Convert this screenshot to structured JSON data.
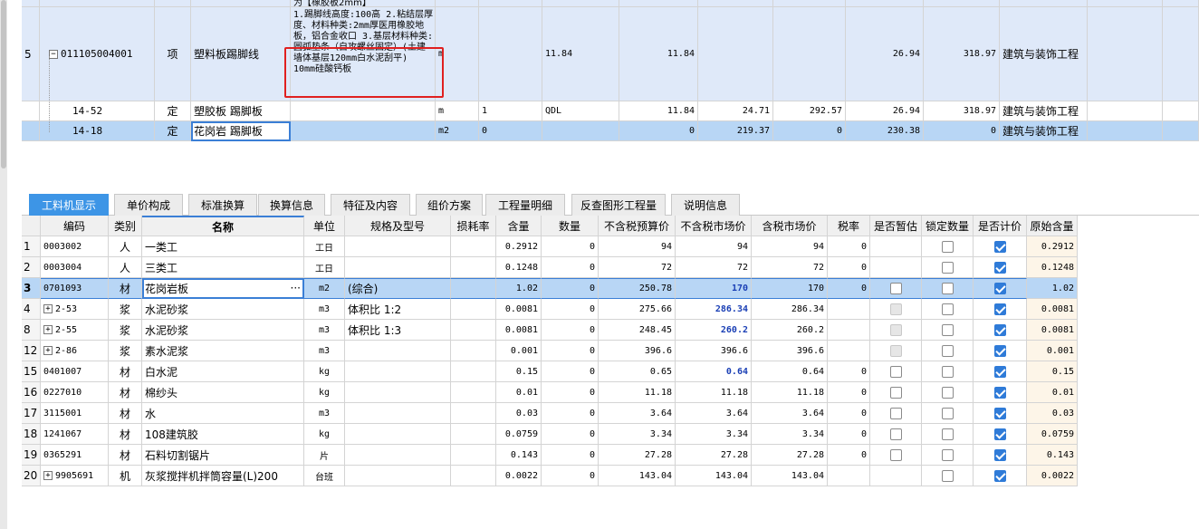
{
  "top_rows": [
    {
      "no": "",
      "code": "",
      "type": "",
      "name": "",
      "desc_partial": "为【橡胶板2mm】"
    },
    {
      "no": "5",
      "code": "011105004001",
      "type": "项",
      "name": "塑料板踢脚线",
      "desc": "1.踢脚线高度:100高 2.粘结层厚度、材料种类:2mm厚医用橡胶地板，铝合金收口 3.基层材料种类:圆弧垫条（自攻螺丝固定）(土建墙体基层120mm白水泥刮平) 10mm硅酸钙板",
      "unit": "m",
      "qty": "",
      "qty_formula": "11.84",
      "amount": "11.84",
      "price": "",
      "total": "",
      "unit_price": "26.94",
      "sum": "318.97",
      "category": "建筑与装饰工程"
    },
    {
      "no": "",
      "code": "14-52",
      "type": "定",
      "name": "塑胶板 踢脚板",
      "desc": "",
      "unit": "m",
      "qty": "1",
      "qty_formula": "QDL",
      "amount": "11.84",
      "price": "24.71",
      "total": "292.57",
      "unit_price": "26.94",
      "sum": "318.97",
      "category": "建筑与装饰工程"
    },
    {
      "no": "",
      "code": "14-18",
      "type": "定",
      "name": "花岗岩 踢脚板",
      "desc": "",
      "unit": "m2",
      "qty": "0",
      "qty_formula": "",
      "amount": "0",
      "price": "219.37",
      "total": "0",
      "unit_price": "230.38",
      "sum": "0",
      "category": "建筑与装饰工程"
    }
  ],
  "tabs": [
    "工料机显示",
    "单价构成",
    "标准换算",
    "换算信息",
    "特征及内容",
    "组价方案",
    "工程量明细",
    "反查图形工程量",
    "说明信息"
  ],
  "columns": [
    "编码",
    "类别",
    "名称",
    "单位",
    "规格及型号",
    "损耗率",
    "含量",
    "数量",
    "不含税预算价",
    "不含税市场价",
    "含税市场价",
    "税率",
    "是否暂估",
    "锁定数量",
    "是否计价",
    "原始含量"
  ],
  "rows": [
    {
      "no": "1",
      "expand": false,
      "code": "0003002",
      "type": "人",
      "name": "一类工",
      "unit": "工日",
      "spec": "",
      "loss": "",
      "content": "0.2912",
      "qty": "0",
      "budget": "94",
      "market": "94",
      "market_blue": false,
      "tax_market": "94",
      "tax": "0",
      "est": "none",
      "lock": "off",
      "priced": "on",
      "orig": "0.2912"
    },
    {
      "no": "2",
      "expand": false,
      "code": "0003004",
      "type": "人",
      "name": "三类工",
      "unit": "工日",
      "spec": "",
      "loss": "",
      "content": "0.1248",
      "qty": "0",
      "budget": "72",
      "market": "72",
      "market_blue": false,
      "tax_market": "72",
      "tax": "0",
      "est": "none",
      "lock": "off",
      "priced": "on",
      "orig": "0.1248"
    },
    {
      "no": "3",
      "expand": false,
      "code": "0701093",
      "type": "材",
      "name": "花岗岩板",
      "unit": "m2",
      "spec": "(综合)",
      "loss": "",
      "content": "1.02",
      "qty": "0",
      "budget": "250.78",
      "market": "170",
      "market_blue": true,
      "tax_market": "170",
      "tax": "0",
      "est": "off",
      "lock": "off",
      "priced": "on",
      "orig": "1.02",
      "selected": true
    },
    {
      "no": "4",
      "expand": true,
      "code": "2-53",
      "type": "浆",
      "name": "水泥砂浆",
      "unit": "m3",
      "spec": "体积比 1:2",
      "loss": "",
      "content": "0.0081",
      "qty": "0",
      "budget": "275.66",
      "market": "286.34",
      "market_blue": true,
      "tax_market": "286.34",
      "tax": "",
      "est": "dis",
      "lock": "off",
      "priced": "on",
      "orig": "0.0081"
    },
    {
      "no": "8",
      "expand": true,
      "code": "2-55",
      "type": "浆",
      "name": "水泥砂浆",
      "unit": "m3",
      "spec": "体积比 1:3",
      "loss": "",
      "content": "0.0081",
      "qty": "0",
      "budget": "248.45",
      "market": "260.2",
      "market_blue": true,
      "tax_market": "260.2",
      "tax": "",
      "est": "dis",
      "lock": "off",
      "priced": "on",
      "orig": "0.0081"
    },
    {
      "no": "12",
      "expand": true,
      "code": "2-86",
      "type": "浆",
      "name": "素水泥浆",
      "unit": "m3",
      "spec": "",
      "loss": "",
      "content": "0.001",
      "qty": "0",
      "budget": "396.6",
      "market": "396.6",
      "market_blue": false,
      "tax_market": "396.6",
      "tax": "",
      "est": "dis",
      "lock": "off",
      "priced": "on",
      "orig": "0.001"
    },
    {
      "no": "15",
      "expand": false,
      "code": "0401007",
      "type": "材",
      "name": "白水泥",
      "unit": "kg",
      "spec": "",
      "loss": "",
      "content": "0.15",
      "qty": "0",
      "budget": "0.65",
      "market": "0.64",
      "market_blue": true,
      "tax_market": "0.64",
      "tax": "0",
      "est": "off",
      "lock": "off",
      "priced": "on",
      "orig": "0.15"
    },
    {
      "no": "16",
      "expand": false,
      "code": "0227010",
      "type": "材",
      "name": "棉纱头",
      "unit": "kg",
      "spec": "",
      "loss": "",
      "content": "0.01",
      "qty": "0",
      "budget": "11.18",
      "market": "11.18",
      "market_blue": false,
      "tax_market": "11.18",
      "tax": "0",
      "est": "off",
      "lock": "off",
      "priced": "on",
      "orig": "0.01"
    },
    {
      "no": "17",
      "expand": false,
      "code": "3115001",
      "type": "材",
      "name": "水",
      "unit": "m3",
      "spec": "",
      "loss": "",
      "content": "0.03",
      "qty": "0",
      "budget": "3.64",
      "market": "3.64",
      "market_blue": false,
      "tax_market": "3.64",
      "tax": "0",
      "est": "off",
      "lock": "off",
      "priced": "on",
      "orig": "0.03"
    },
    {
      "no": "18",
      "expand": false,
      "code": "1241067",
      "type": "材",
      "name": "108建筑胶",
      "unit": "kg",
      "spec": "",
      "loss": "",
      "content": "0.0759",
      "qty": "0",
      "budget": "3.34",
      "market": "3.34",
      "market_blue": false,
      "tax_market": "3.34",
      "tax": "0",
      "est": "off",
      "lock": "off",
      "priced": "on",
      "orig": "0.0759"
    },
    {
      "no": "19",
      "expand": false,
      "code": "0365291",
      "type": "材",
      "name": "石料切割锯片",
      "unit": "片",
      "spec": "",
      "loss": "",
      "content": "0.143",
      "qty": "0",
      "budget": "27.28",
      "market": "27.28",
      "market_blue": false,
      "tax_market": "27.28",
      "tax": "0",
      "est": "off",
      "lock": "off",
      "priced": "on",
      "orig": "0.143"
    },
    {
      "no": "20",
      "expand": true,
      "code": "9905691",
      "type": "机",
      "name": "灰浆搅拌机拌筒容量(L)200",
      "unit": "台班",
      "spec": "",
      "loss": "",
      "content": "0.0022",
      "qty": "0",
      "budget": "143.04",
      "market": "143.04",
      "market_blue": false,
      "tax_market": "143.04",
      "tax": "",
      "est": "none",
      "lock": "off",
      "priced": "on",
      "orig": "0.0022"
    }
  ],
  "ellipsis": "···",
  "colors": {
    "accent": "#3d95e6",
    "selected_row": "#b8d6f5",
    "item_row": "#dfe9f9",
    "highlight": "#e02020",
    "blue_value": "#1a3fb5"
  }
}
